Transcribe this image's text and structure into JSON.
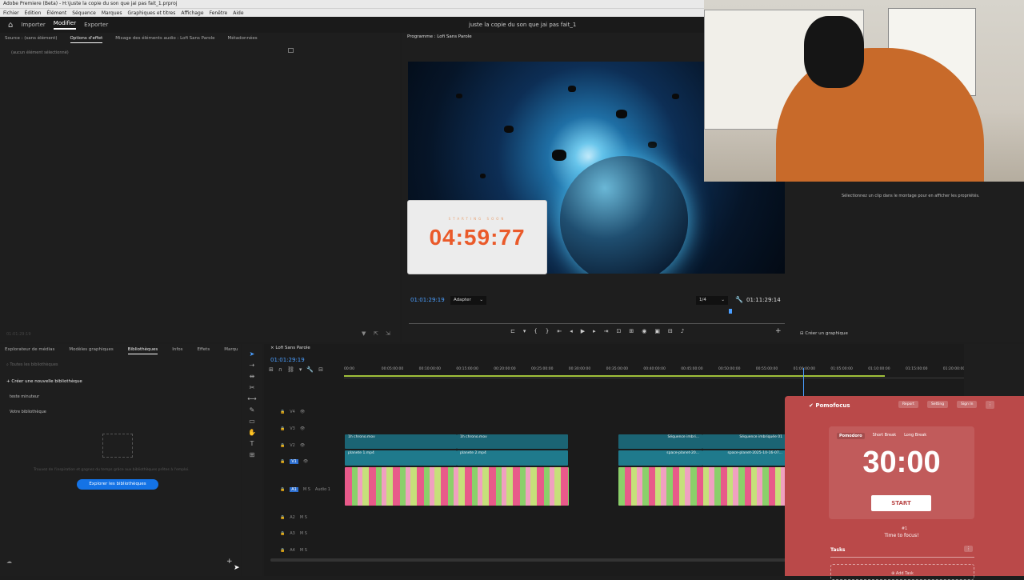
{
  "window": {
    "title": "Adobe Premiere (Beta) - H:\\juste la copie du son que jai pas fait_1.prproj",
    "menu": [
      "Fichier",
      "Édition",
      "Élément",
      "Séquence",
      "Marques",
      "Graphiques et titres",
      "Affichage",
      "Fenêtre",
      "Aide"
    ]
  },
  "appbar": {
    "tabs": [
      "Importer",
      "Modifier",
      "Exporter"
    ],
    "selected": "Modifier",
    "doc_title": "juste la copie du son que jai pas fait_1"
  },
  "source_panel": {
    "tabs": [
      "Source : (sans élément)",
      "Options d'effet",
      "Mixage des éléments audio : Lofi Sans Parole",
      "Métadonnées"
    ],
    "active_tab": "Options d'effet",
    "empty_text": "(aucun élément sélectionné)",
    "timecode": "01:01:29:19"
  },
  "program_panel": {
    "title": "Programme : Lofi Sans Parole",
    "timecode_left": "01:01:29:19",
    "fit": "Adapter",
    "quality": "1/4",
    "timecode_right": "01:11:29:14",
    "overlay_timer": "04:59:77",
    "overlay_sub": "STARTING SOON"
  },
  "properties_panel": {
    "hint": "Sélectionnez un clip dans le montage pour en afficher les propriétés.",
    "create_graphic": "Créer un graphique"
  },
  "libraries_panel": {
    "tabs": [
      "Explorateur de médias",
      "Modèles graphiques",
      "Bibliothèques",
      "Infos",
      "Effets",
      "Marqu"
    ],
    "active_tab": "Bibliothèques",
    "search_placeholder": "Toutes les bibliothèques",
    "create_new": "Créer une nouvelle bibliothèque",
    "items": [
      "teste minuteur",
      "Votre bibliothèque"
    ],
    "hint": "Trouvez de l'inspiration et gagnez du temps grâce aux bibliothèques prêtes à l'emploi.",
    "explore_button": "Explorer les bibliothèques"
  },
  "timeline": {
    "sequence_name": "Lofi Sans Parole",
    "timecode": "01:01:29:19",
    "ruler": [
      "00:00",
      "00:05:00:00",
      "00:10:00:00",
      "00:15:00:00",
      "00:20:00:00",
      "00:25:00:00",
      "00:30:00:00",
      "00:35:00:00",
      "00:40:00:00",
      "00:45:00:00",
      "00:50:00:00",
      "00:55:00:00",
      "01:00:00:00",
      "01:05:00:00",
      "01:10:00:00",
      "01:15:00:00",
      "01:20:00:00"
    ],
    "tracks": [
      "V4",
      "V3",
      "V2",
      "V1",
      "A1",
      "A2",
      "A3",
      "A4"
    ],
    "a1_label": "Audio 1",
    "clips": {
      "v2_a": "1h chrono.mov",
      "v2_b": "1h chrono.mov",
      "v1_a": "planete 1.mp4",
      "v1_b": "planete 2.mp4",
      "v2_c": "Séquence imbri...",
      "v2_d": "Séquence imbriquée 01",
      "v1_c": "space-planet-20...",
      "v1_d": "space-planet-2025-10-16-07..."
    }
  },
  "pomofocus": {
    "brand": "Pomofocus",
    "report": "Report",
    "setting": "Setting",
    "signin": "Sign In",
    "modes": [
      "Pomodoro",
      "Short Break",
      "Long Break"
    ],
    "active_mode": "Pomodoro",
    "time": "30:00",
    "start": "START",
    "counter": "#1",
    "focus": "Time to focus!",
    "tasks": "Tasks",
    "add_task": "Add Task",
    "bg": "#ba4949"
  },
  "colors": {
    "accent": "#2d8ceb",
    "clip_video": "#1f7a8c",
    "clip_v2": "#1b6474",
    "clip_audio_pink": "#e85a8a",
    "clip_audio_green": "#8bd06a"
  }
}
